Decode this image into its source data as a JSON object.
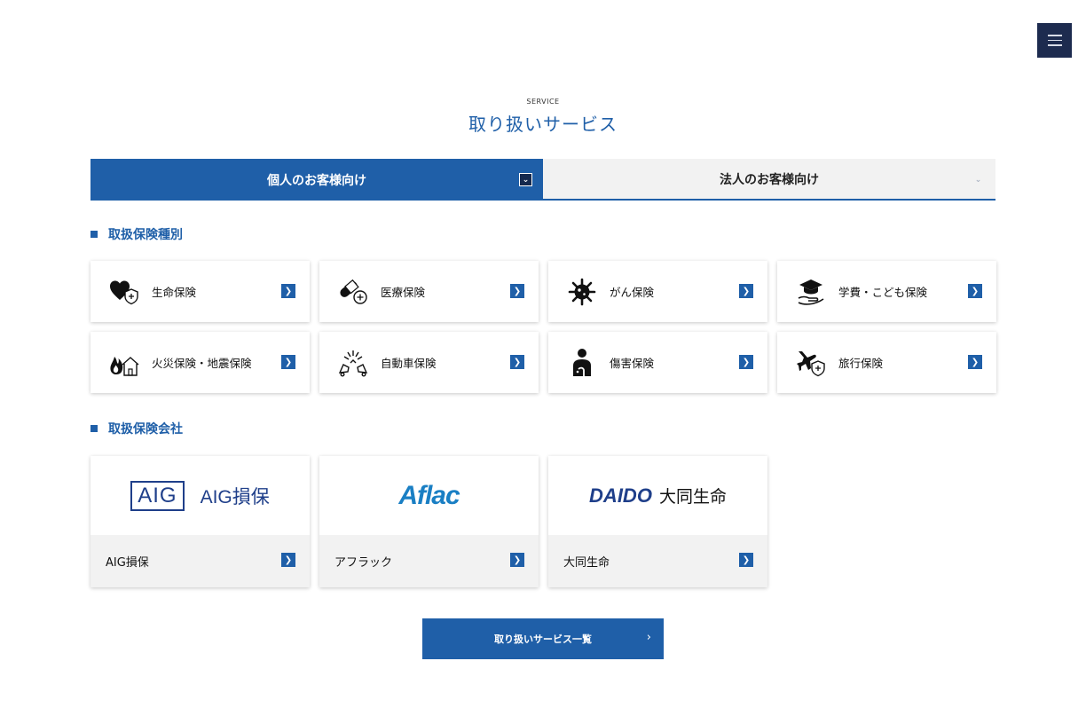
{
  "header": {
    "menu_icon": "hamburger-icon"
  },
  "section": {
    "eyebrow": "SERVICE",
    "title": "取り扱いサービス"
  },
  "tabs": [
    {
      "label": "個人のお客様向け",
      "active": true,
      "icon": "chevron-down-icon"
    },
    {
      "label": "法人のお客様向け",
      "active": false,
      "icon": "chevron-down-icon"
    }
  ],
  "types_title": "取扱保険種別",
  "insurance_types": [
    {
      "label": "生命保険",
      "icon": "heart-shield-icon"
    },
    {
      "label": "医療保険",
      "icon": "pill-shield-icon"
    },
    {
      "label": "がん保険",
      "icon": "virus-icon"
    },
    {
      "label": "学費・こども保険",
      "icon": "graduation-cap-hand-icon"
    },
    {
      "label": "火災保険・地震保険",
      "icon": "fire-house-icon"
    },
    {
      "label": "自動車保険",
      "icon": "car-crash-icon"
    },
    {
      "label": "傷害保険",
      "icon": "injured-person-icon"
    },
    {
      "label": "旅行保険",
      "icon": "airplane-shield-icon"
    }
  ],
  "companies_title": "取扱保険会社",
  "companies": [
    {
      "label": "AIG損保",
      "logo_box": "AIG",
      "logo_text": "AIG損保"
    },
    {
      "label": "アフラック",
      "logo_text": "Aflac"
    },
    {
      "label": "大同生命",
      "logo_box": "DAIDO",
      "logo_text": "大同生命"
    }
  ],
  "list_button": "取り扱いサービス一覧",
  "colors": {
    "primary": "#1f5fa8",
    "navy": "#1d2b4f",
    "tab_inactive": "#f2f2f2"
  }
}
